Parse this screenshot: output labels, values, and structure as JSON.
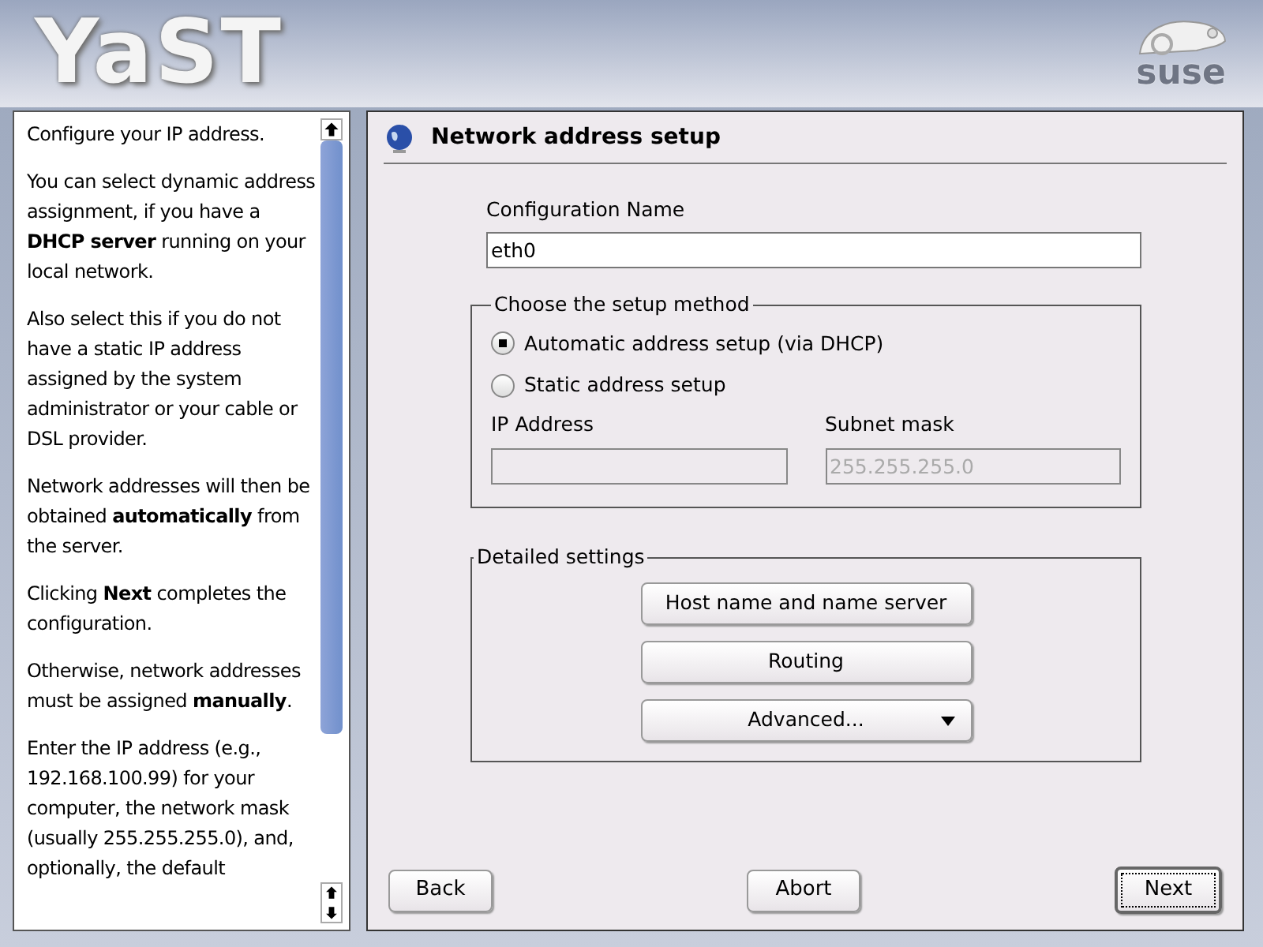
{
  "header": {
    "logo": "YaST",
    "brand": "suse"
  },
  "help": {
    "paragraphs": [
      "Configure your IP address.",
      "You can select dynamic address assignment, if you have a **DHCP server** running on your local network.",
      "Also select this if you do not have a static IP address assigned by the system administrator or your cable or DSL provider.",
      "Network addresses will then be obtained **automatically** from the server.",
      "Clicking **Next** completes the configuration.",
      "Otherwise, network addresses must be assigned **manually**.",
      "Enter the IP address (e.g., 192.168.100.99) for your computer, the network mask (usually 255.255.255.0), and, optionally, the default"
    ]
  },
  "dialog": {
    "title": "Network address setup",
    "config_name": {
      "label": "Configuration Name",
      "value": "eth0"
    },
    "setup_method": {
      "title": "Choose the setup method",
      "options": [
        {
          "label": "Automatic address setup (via DHCP)",
          "selected": true
        },
        {
          "label": "Static address setup",
          "selected": false
        }
      ],
      "fields": [
        {
          "label": "IP Address",
          "disabled": true
        },
        {
          "label": "Subnet mask",
          "value": "255.255.255.0",
          "disabled": true
        }
      ]
    },
    "detailed": {
      "title": "Detailed settings",
      "buttons": [
        {
          "label": "Host name and name server",
          "kind": "plain"
        },
        {
          "label": "Routing",
          "kind": "plain"
        },
        {
          "label": "Advanced...",
          "kind": "menu"
        }
      ]
    },
    "buttons": [
      {
        "label": "Back",
        "default": false
      },
      {
        "label": "Abort",
        "default": false
      },
      {
        "label": "Next",
        "default": true
      }
    ]
  }
}
